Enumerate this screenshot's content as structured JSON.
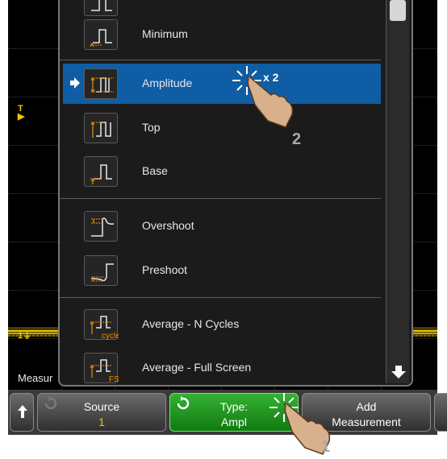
{
  "menu": {
    "items": [
      {
        "label": "Minimum",
        "icon": "minimum-measure-icon",
        "selected": false
      },
      {
        "label": "Amplitude",
        "icon": "amplitude-measure-icon",
        "selected": true
      },
      {
        "label": "Top",
        "icon": "top-measure-icon",
        "selected": false
      },
      {
        "label": "Base",
        "icon": "base-measure-icon",
        "selected": false
      },
      {
        "label": "Overshoot",
        "icon": "overshoot-measure-icon",
        "selected": false
      },
      {
        "label": "Preshoot",
        "icon": "preshoot-measure-icon",
        "selected": false
      },
      {
        "label": "Average - N Cycles",
        "icon": "average-n-cycles-icon",
        "selected": false
      },
      {
        "label": "Average - Full Screen",
        "icon": "average-full-screen-icon",
        "selected": false
      }
    ],
    "thumb_tags": {
      "cycle": "cycle",
      "fs": "FS"
    }
  },
  "scope": {
    "trigger_marker": "T",
    "channel_marker": "1",
    "measure_label": "Measur"
  },
  "softkeys": {
    "source": {
      "line1": "Source",
      "line2": "1"
    },
    "type": {
      "line1": "Type:",
      "line2": "Ampl"
    },
    "add": {
      "line1": "Add",
      "line2": "Measurement"
    }
  },
  "annotations": {
    "callout_1": "1",
    "callout_2": "2",
    "tap_count": "x 2"
  },
  "colors": {
    "selection": "#0f5da5",
    "trace": "#f0c800",
    "softkey_active": "#22a022",
    "softkey_value": "#f0c800",
    "icon_orange": "#f09000"
  }
}
